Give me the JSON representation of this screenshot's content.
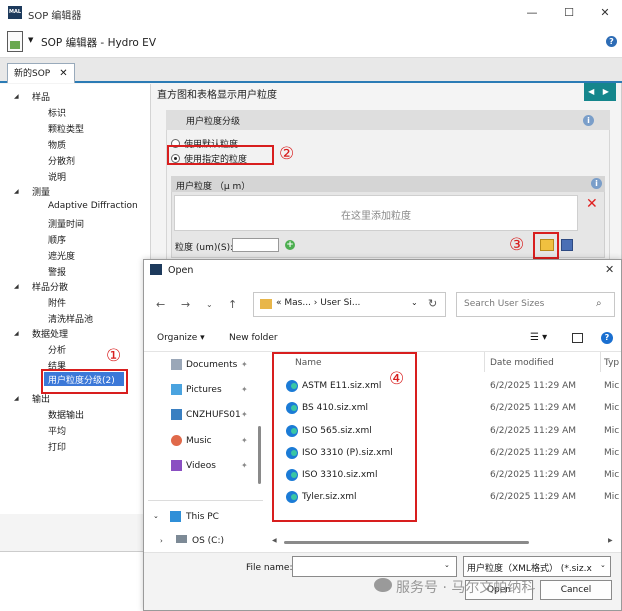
{
  "window": {
    "title": "SOP 编辑器",
    "app_title": "SOP 编辑器 - Hydro EV",
    "controls": {
      "minimize": "—",
      "maximize": "☐",
      "close": "✕"
    }
  },
  "tab": {
    "label": "新的SOP",
    "close": "✕"
  },
  "tree": {
    "groups": [
      {
        "label": "样品",
        "items": [
          "标识",
          "颗粒类型",
          "物质",
          "分散剂",
          "说明"
        ]
      },
      {
        "label": "测量",
        "items": [
          "Adaptive Diffraction",
          "测量时间",
          "顺序",
          "遮光度",
          "警报"
        ]
      },
      {
        "label": "样品分散",
        "items": [
          "附件",
          "清洗样品池"
        ]
      },
      {
        "label": "数据处理",
        "items": [
          "分析",
          "结果",
          "用户粒度分级(2)"
        ]
      },
      {
        "label": "输出",
        "items": [
          "数据输出",
          "平均",
          "打印"
        ]
      }
    ],
    "selected": "用户粒度分级(2)"
  },
  "panel": {
    "heading": "直方图和表格显示用户粒度",
    "nav_arrows": "◀ ▶",
    "group_title": "用户粒度分级",
    "radio_default": "使用默认粒度",
    "radio_custom": "使用指定的粒度",
    "custom_title": "用户粒度 （μ m）",
    "add_hint": "在这里添加粒度",
    "size_label": "粒度 (um)(S):",
    "size_value": ""
  },
  "annotations": [
    "①",
    "②",
    "③",
    "④"
  ],
  "dialog": {
    "title": "Open",
    "address": "« Mas... › User Si...",
    "search_placeholder": "Search User Sizes",
    "organize": "Organize ▾",
    "new_folder": "New folder",
    "nav": [
      {
        "label": "Documents",
        "icon": "documents-icon",
        "pinned": true
      },
      {
        "label": "Pictures",
        "icon": "pictures-icon",
        "pinned": true
      },
      {
        "label": "CNZHUFS01",
        "icon": "network-drive-icon",
        "pinned": true
      },
      {
        "label": "Music",
        "icon": "music-icon",
        "pinned": true
      },
      {
        "label": "Videos",
        "icon": "videos-icon",
        "pinned": true
      },
      {
        "label": "This PC",
        "icon": "pc-icon",
        "pinned": false
      },
      {
        "label": "OS (C:)",
        "icon": "drive-icon",
        "pinned": false
      }
    ],
    "columns": {
      "name": "Name",
      "date": "Date modified",
      "type": "Typ"
    },
    "files": [
      {
        "name": "ASTM E11.siz.xml",
        "date": "6/2/2025 11:29 AM",
        "type": "Mic"
      },
      {
        "name": "BS 410.siz.xml",
        "date": "6/2/2025 11:29 AM",
        "type": "Mic"
      },
      {
        "name": "ISO 565.siz.xml",
        "date": "6/2/2025 11:29 AM",
        "type": "Mic"
      },
      {
        "name": "ISO 3310 (P).siz.xml",
        "date": "6/2/2025 11:29 AM",
        "type": "Mic"
      },
      {
        "name": "ISO 3310.siz.xml",
        "date": "6/2/2025 11:29 AM",
        "type": "Mic"
      },
      {
        "name": "Tyler.siz.xml",
        "date": "6/2/2025 11:29 AM",
        "type": "Mic"
      }
    ],
    "file_name_label": "File name:",
    "file_name_value": "",
    "file_type": "用户粒度（XML格式） (*.siz.x",
    "open": "Open",
    "cancel": "Cancel"
  },
  "watermark": "服务号 · 马尔文帕纳科"
}
